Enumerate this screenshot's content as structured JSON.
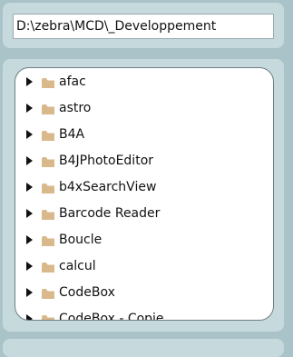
{
  "path_field": {
    "value": "D:\\zebra\\MCD\\_Developpement"
  },
  "tree": {
    "items": [
      {
        "label": "afac"
      },
      {
        "label": "astro"
      },
      {
        "label": "B4A"
      },
      {
        "label": "B4JPhotoEditor"
      },
      {
        "label": "b4xSearchView"
      },
      {
        "label": "Barcode Reader"
      },
      {
        "label": "Boucle"
      },
      {
        "label": "calcul"
      },
      {
        "label": "CodeBox"
      },
      {
        "label": "CodeBox - Copie"
      }
    ]
  },
  "icons": {
    "expand": "triangle-right-icon",
    "folder": "folder-icon"
  },
  "colors": {
    "background": "#a9c3c9",
    "panel": "#c6d9dd",
    "folder": "#d9b98c"
  }
}
